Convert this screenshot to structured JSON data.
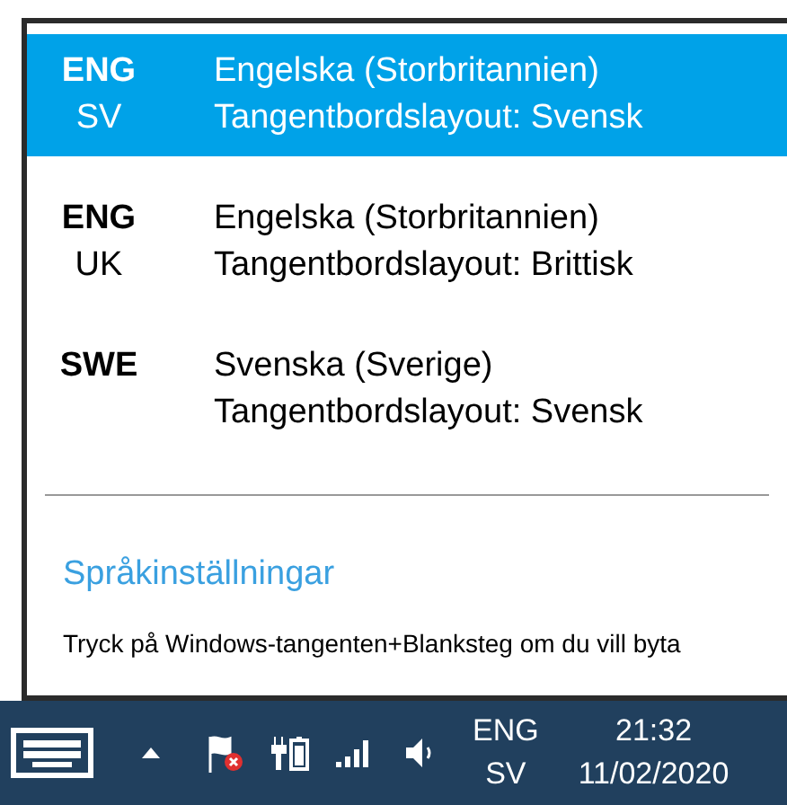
{
  "languages": [
    {
      "code": "ENG",
      "sub": "SV",
      "name": "Engelska (Storbritannien)",
      "layout": "Tangentbordslayout: Svensk",
      "selected": true
    },
    {
      "code": "ENG",
      "sub": "UK",
      "name": "Engelska (Storbritannien)",
      "layout": "Tangentbordslayout: Brittisk",
      "selected": false
    },
    {
      "code": "SWE",
      "name": "Svenska (Sverige)",
      "layout": "Tangentbordslayout: Svensk",
      "selected": false
    }
  ],
  "settings_link": "Språkinställningar",
  "hint": "Tryck på Windows-tangenten+Blanksteg om du vill byta",
  "taskbar": {
    "input_code": "ENG",
    "input_sub": "SV",
    "time": "21:32",
    "date": "11/02/2020"
  }
}
